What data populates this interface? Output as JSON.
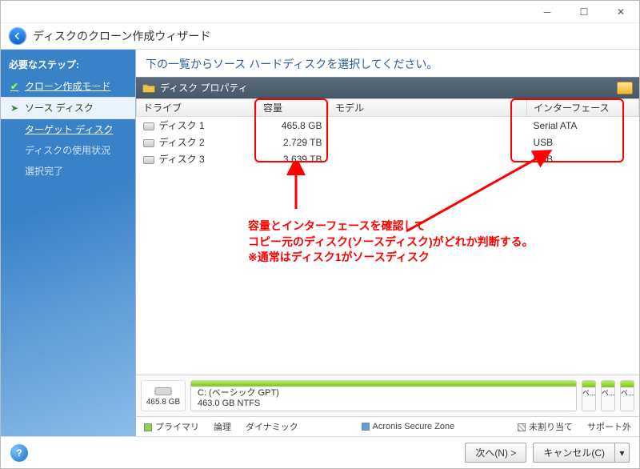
{
  "window_title": "ディスクのクローン作成ウィザード",
  "sidebar": {
    "heading": "必要なステップ:",
    "items": [
      {
        "label": "クローン作成モード",
        "state": "done"
      },
      {
        "label": "ソース ディスク",
        "state": "active"
      },
      {
        "label": "ターゲット ディスク",
        "state": "pending_link"
      },
      {
        "label": "ディスクの使用状況",
        "state": "pending_dim"
      },
      {
        "label": "選択完了",
        "state": "pending_dim"
      }
    ]
  },
  "instruction": "下の一覧からソース ハードディスクを選択してください。",
  "panel_title": "ディスク プロパティ",
  "columns": {
    "drive": "ドライブ",
    "capacity": "容量",
    "model": "モデル",
    "interface": "インターフェース"
  },
  "rows": [
    {
      "drive": "ディスク 1",
      "capacity": "465.8 GB",
      "model": "",
      "interface": "Serial ATA"
    },
    {
      "drive": "ディスク 2",
      "capacity": "2.729 TB",
      "model": "",
      "interface": "USB"
    },
    {
      "drive": "ディスク 3",
      "capacity": "3.639 TB",
      "model": "",
      "interface": "USB"
    }
  ],
  "annotations": {
    "line1": "容量とインターフェースを確認して",
    "line2": "コピー元のディスク(ソースディスク)がどれか判断する。",
    "line3": "※通常はディスク1がソースディスク"
  },
  "viz": {
    "total": "465.8 GB",
    "partition_name": "C: (ベーシック GPT)",
    "partition_size": "463.0 GB NTFS",
    "stub_label": "ベ..."
  },
  "legend": {
    "primary": "プライマリ",
    "logical": "論理",
    "dynamic": "ダイナミック",
    "acronis": "Acronis Secure Zone",
    "unalloc": "未割り当て",
    "unsupported": "サポート外"
  },
  "footer": {
    "next": "次へ(N) >",
    "cancel": "キャンセル(C)"
  }
}
